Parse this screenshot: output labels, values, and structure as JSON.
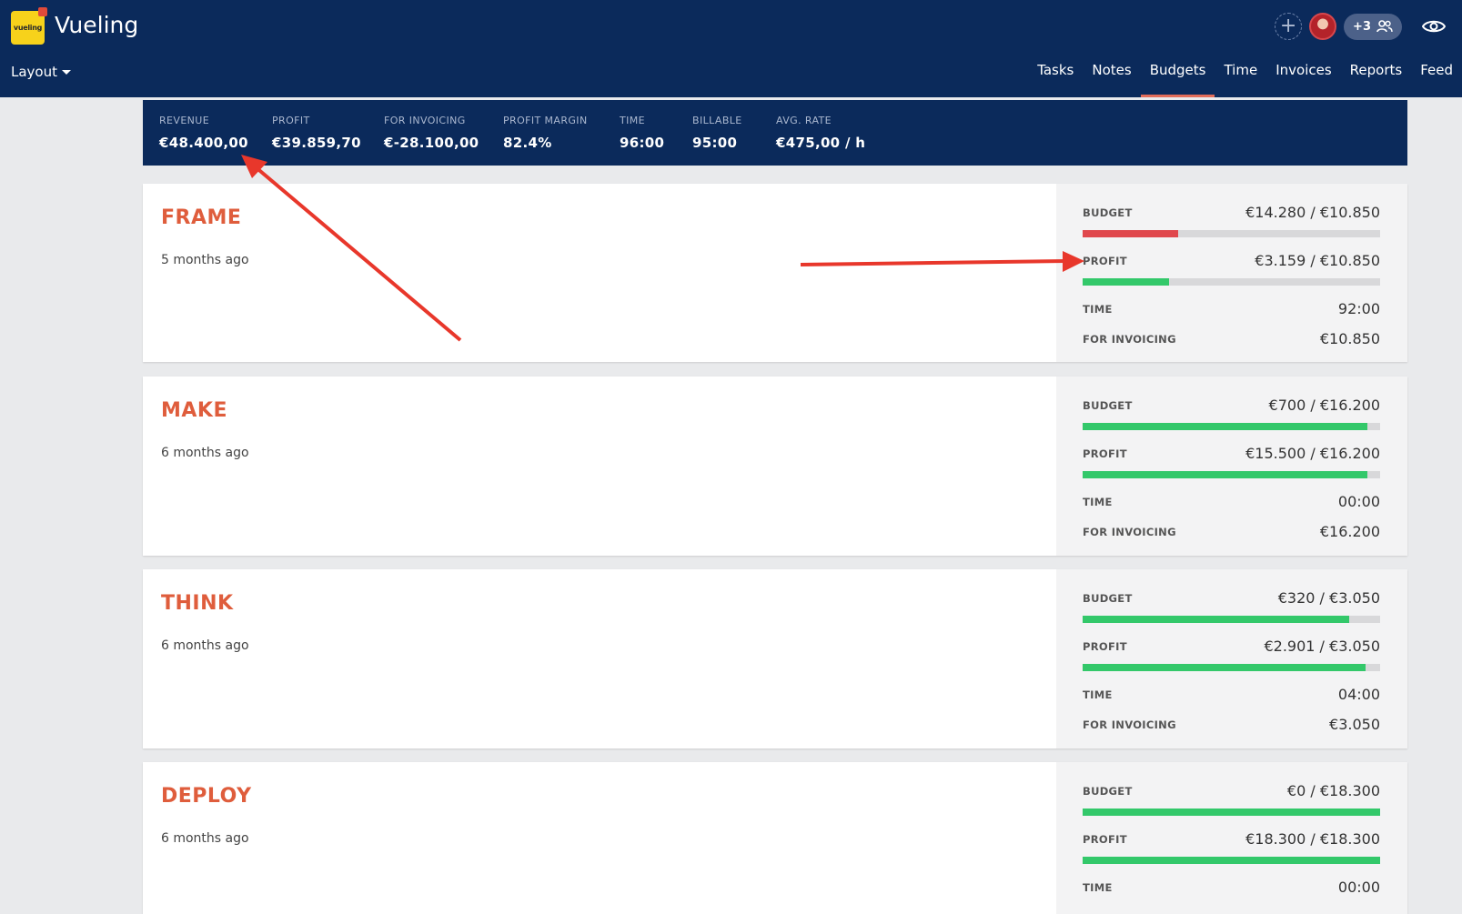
{
  "app": {
    "title": "Vueling",
    "logo_text": "vueling",
    "layout_label": "Layout"
  },
  "header": {
    "members_count": "+3"
  },
  "nav": [
    {
      "label": "Tasks",
      "active": false
    },
    {
      "label": "Notes",
      "active": false
    },
    {
      "label": "Budgets",
      "active": true
    },
    {
      "label": "Time",
      "active": false
    },
    {
      "label": "Invoices",
      "active": false
    },
    {
      "label": "Reports",
      "active": false
    },
    {
      "label": "Feed",
      "active": false
    }
  ],
  "stats": [
    {
      "label": "REVENUE",
      "value": "€48.400,00"
    },
    {
      "label": "PROFIT",
      "value": "€39.859,70"
    },
    {
      "label": "FOR INVOICING",
      "value": "€-28.100,00"
    },
    {
      "label": "PROFIT MARGIN",
      "value": "82.4%"
    },
    {
      "label": "TIME",
      "value": "96:00"
    },
    {
      "label": "BILLABLE",
      "value": "95:00"
    },
    {
      "label": "AVG. RATE",
      "value": "€475,00 / h"
    }
  ],
  "labels": {
    "budget": "BUDGET",
    "profit": "PROFIT",
    "time": "TIME",
    "for_invoicing": "FOR INVOICING"
  },
  "colors": {
    "header_bg": "#0b2a5b",
    "accent": "#df5d3c",
    "bar_red": "#e0474c",
    "bar_green": "#33c86a",
    "arrow": "#e8372b"
  },
  "phases": [
    {
      "title": "FRAME",
      "date": "5 months ago",
      "budget": "€14.280 / €10.850",
      "budget_fill": 0.32,
      "budget_color": "red",
      "profit": "€3.159 / €10.850",
      "profit_fill": 0.29,
      "time": "92:00",
      "for_invoicing": "€10.850"
    },
    {
      "title": "MAKE",
      "date": "6 months ago",
      "budget": "€700 / €16.200",
      "budget_fill": 0.957,
      "budget_color": "green",
      "profit": "€15.500 / €16.200",
      "profit_fill": 0.957,
      "time": "00:00",
      "for_invoicing": "€16.200"
    },
    {
      "title": "THINK",
      "date": "6 months ago",
      "budget": "€320 / €3.050",
      "budget_fill": 0.895,
      "budget_color": "green",
      "profit": "€2.901 / €3.050",
      "profit_fill": 0.951,
      "time": "04:00",
      "for_invoicing": "€3.050"
    },
    {
      "title": "DEPLOY",
      "date": "6 months ago",
      "budget": "€0 / €18.300",
      "budget_fill": 1.0,
      "budget_color": "green",
      "profit": "€18.300 / €18.300",
      "profit_fill": 1.0,
      "time": "00:00",
      "for_invoicing": ""
    }
  ]
}
